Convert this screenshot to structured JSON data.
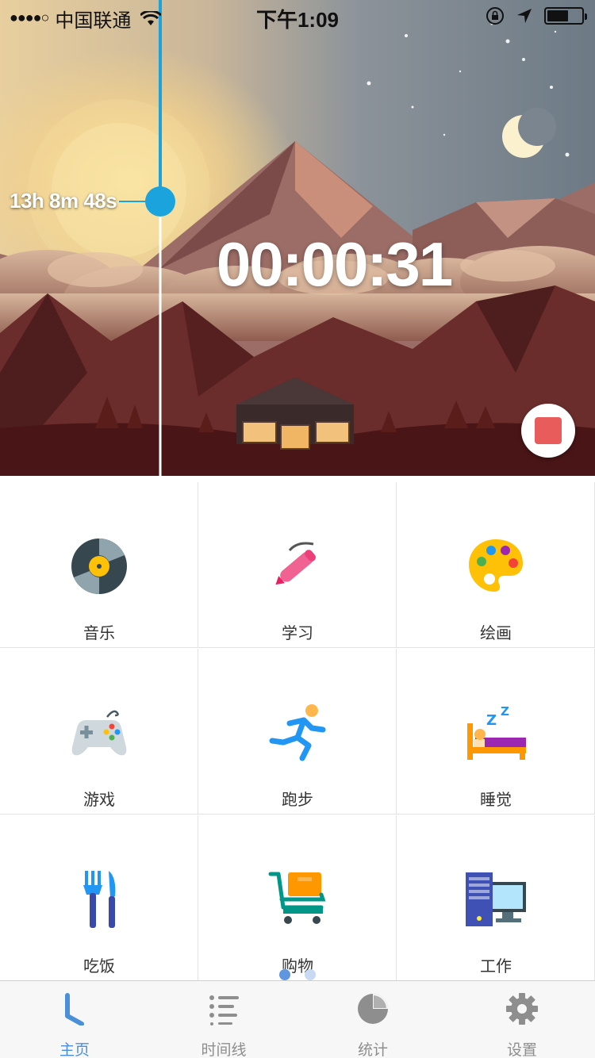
{
  "status_bar": {
    "signal": "●●●●○",
    "carrier": "中国联通",
    "time": "下午1:09"
  },
  "hero": {
    "elapsed": "13h 8m 48s",
    "timer": "00:00:31"
  },
  "categories": [
    {
      "label": "音乐",
      "icon": "vinyl-record-icon"
    },
    {
      "label": "学习",
      "icon": "pen-icon"
    },
    {
      "label": "绘画",
      "icon": "paint-palette-icon"
    },
    {
      "label": "游戏",
      "icon": "gamepad-icon"
    },
    {
      "label": "跑步",
      "icon": "running-person-icon"
    },
    {
      "label": "睡觉",
      "icon": "bed-sleep-icon"
    },
    {
      "label": "吃饭",
      "icon": "fork-knife-icon"
    },
    {
      "label": "购物",
      "icon": "shopping-cart-icon"
    },
    {
      "label": "工作",
      "icon": "desktop-computer-icon"
    }
  ],
  "pager": {
    "pages": 2,
    "current": 1
  },
  "tabs": [
    {
      "label": "主页",
      "icon": "home-clock-icon",
      "active": true
    },
    {
      "label": "时间线",
      "icon": "timeline-list-icon",
      "active": false
    },
    {
      "label": "统计",
      "icon": "pie-chart-icon",
      "active": false
    },
    {
      "label": "设置",
      "icon": "gear-icon",
      "active": false
    }
  ],
  "colors": {
    "accent": "#4a90d9",
    "timeline_marker": "#1aa3dc",
    "stop": "#e85c5c",
    "tab_inactive": "#8e8e8e"
  }
}
